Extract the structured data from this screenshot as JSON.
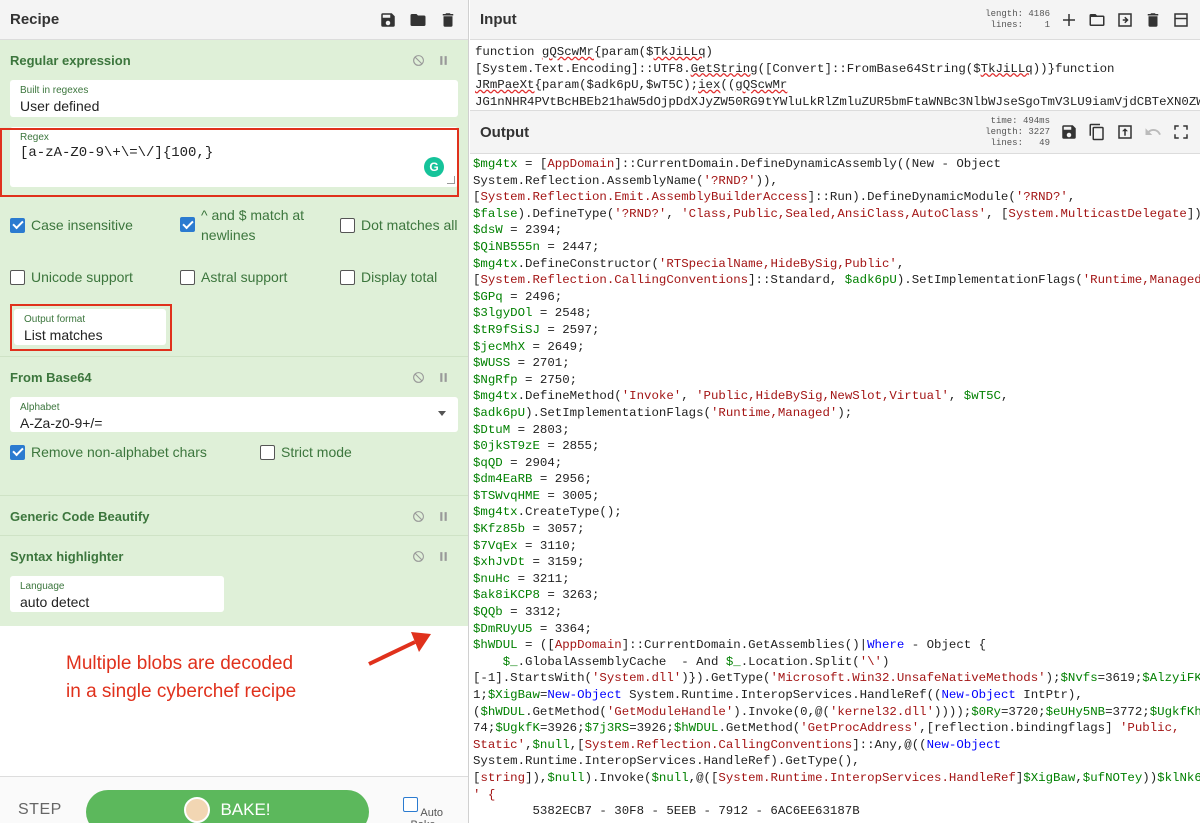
{
  "recipe": {
    "title": "Recipe",
    "operations": {
      "regex": {
        "title": "Regular expression",
        "builtin_label": "Built in regexes",
        "builtin_value": "User defined",
        "regex_label": "Regex",
        "regex_value": "[a-zA-Z0-9\\+\\=\\/]{100,}",
        "case_insensitive": "Case insensitive",
        "multiline_a": "^ and $ match at",
        "multiline_b": "newlines",
        "dot_all": "Dot matches all",
        "unicode": "Unicode support",
        "astral": "Astral support",
        "display_total": "Display total",
        "output_label": "Output format",
        "output_value": "List matches"
      },
      "base64": {
        "title": "From Base64",
        "alphabet_label": "Alphabet",
        "alphabet_value": "A-Za-z0-9+/=",
        "remove_non_alpha": "Remove non-alphabet chars",
        "strict": "Strict mode"
      },
      "beautify": {
        "title": "Generic Code Beautify"
      },
      "syntax": {
        "title": "Syntax highlighter",
        "language_label": "Language",
        "language_value": "auto detect"
      }
    },
    "annotation_1": "Multiple blobs are decoded",
    "annotation_2": "in a single cyberchef recipe",
    "step": "STEP",
    "bake": "BAKE!",
    "auto_bake": "Auto Bake"
  },
  "input": {
    "title": "Input",
    "length": "length: 4186",
    "lines": "lines:    1"
  },
  "output": {
    "title": "Output",
    "time": "time: 494ms",
    "length": "length: 3227",
    "lines": "lines:   49"
  },
  "colors": {
    "accent_green": "#5cb85c",
    "op_bg": "#dff0d8",
    "annotation_red": "#e0311c",
    "check_blue": "#2b7bd0"
  },
  "icons": [
    "save-icon",
    "folder-icon",
    "trash-icon",
    "plus-icon",
    "import-icon",
    "copy-icon",
    "undo-icon",
    "maximize-icon",
    "disable-icon",
    "pause-icon",
    "chevron-down-icon",
    "grammarly-icon",
    "chef-icon"
  ]
}
